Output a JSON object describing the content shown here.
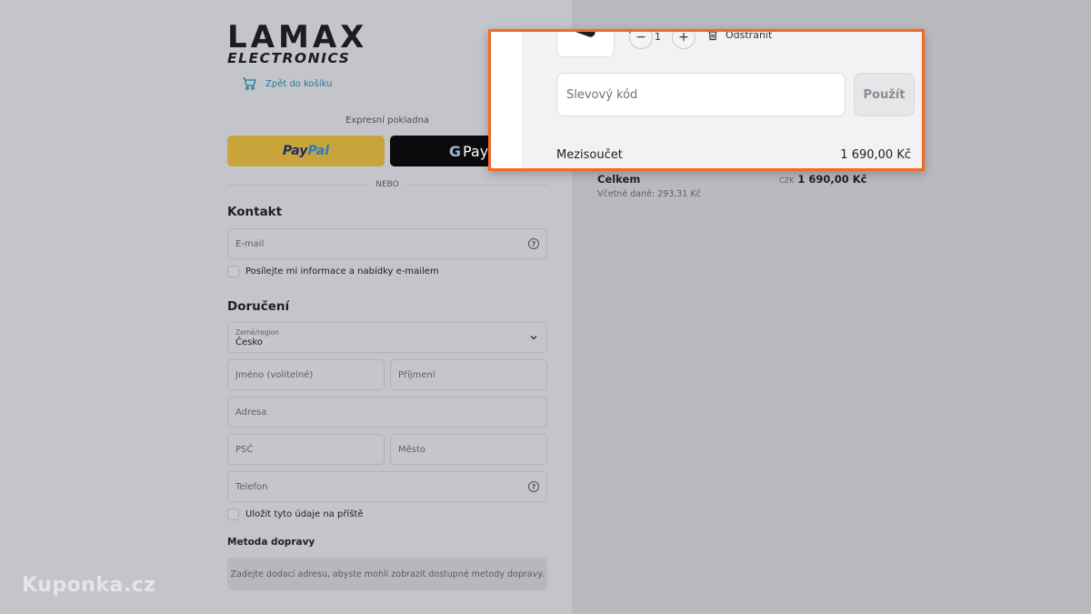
{
  "brand": {
    "logo_main": "LAMAX",
    "logo_sub": "ELECTRONICS"
  },
  "nav": {
    "back_label": "Zpět do košíku"
  },
  "express": {
    "label": "Expresní pokladna",
    "paypal_part1": "Pay",
    "paypal_part2": "Pal",
    "gpay_letter": "G",
    "gpay_text": "Pay",
    "divider_label": "NEBO"
  },
  "contact": {
    "title": "Kontakt",
    "email_placeholder": "E-mail",
    "newsletter_label": "Posílejte mi informace a nabídky e-mailem"
  },
  "delivery": {
    "title": "Doručení",
    "country_label": "Země/region",
    "country_value": "Česko",
    "first_name_placeholder": "Jméno (volitelné)",
    "last_name_placeholder": "Příjmení",
    "address_placeholder": "Adresa",
    "zip_placeholder": "PSČ",
    "city_placeholder": "Město",
    "phone_placeholder": "Telefon",
    "save_label": "Uložit tyto údaje na příště"
  },
  "shipping": {
    "title": "Metoda dopravy",
    "note": "Zadejte dodací adresu, abyste mohli zobrazit dostupné metody dopravy."
  },
  "summary": {
    "total_label": "Celkem",
    "tax_note": "Včetně daně: 293,31 Kč",
    "currency_code": "CZK",
    "total_amount": "1 690,00 Kč"
  },
  "zoom": {
    "qty_value": "1",
    "minus": "−",
    "plus": "+",
    "remove_label": "Odstranit",
    "discount_placeholder": "Slevový kód",
    "apply_label": "Použít",
    "subtotal_label": "Mezisoučet",
    "subtotal_value": "1 690,00 Kč"
  },
  "watermark": "Kuponka.cz",
  "colors": {
    "accent": "#f26a24",
    "paypal": "#c9a43b",
    "link": "#237a96"
  }
}
